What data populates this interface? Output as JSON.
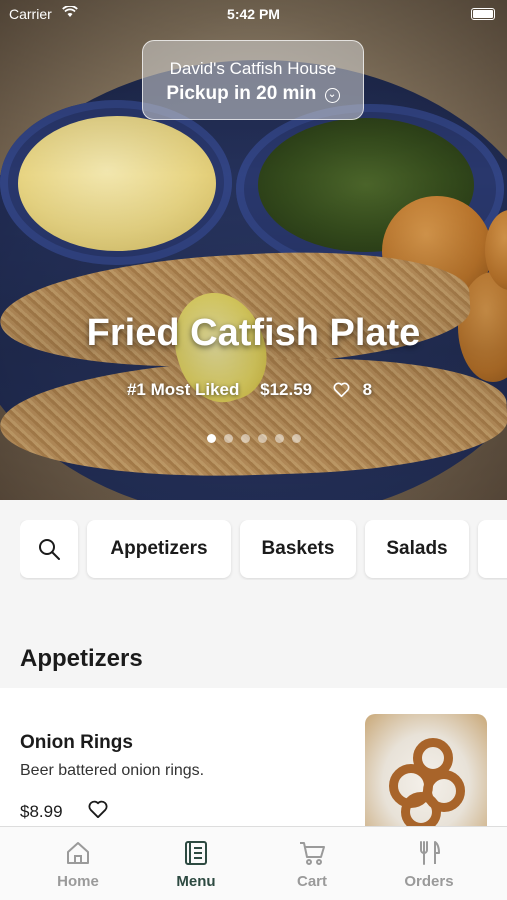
{
  "status_bar": {
    "carrier": "Carrier",
    "time": "5:42 PM"
  },
  "pickup": {
    "restaurant": "David's Catfish House",
    "label": "Pickup in 20 min"
  },
  "featured": {
    "title": "Fried Catfish Plate",
    "rank": "#1 Most Liked",
    "price": "$12.59",
    "likes": "8",
    "carousel_total": 6,
    "carousel_active_index": 0
  },
  "categories": [
    "Appetizers",
    "Baskets",
    "Salads"
  ],
  "section": {
    "title": "Appetizers"
  },
  "items": [
    {
      "name": "Onion Rings",
      "description": "Beer battered onion rings.",
      "price": "$8.99"
    }
  ],
  "tabs": [
    {
      "label": "Home",
      "icon": "home-icon",
      "active": false
    },
    {
      "label": "Menu",
      "icon": "menu-icon",
      "active": true
    },
    {
      "label": "Cart",
      "icon": "cart-icon",
      "active": false
    },
    {
      "label": "Orders",
      "icon": "orders-icon",
      "active": false
    }
  ],
  "colors": {
    "active_tab": "#2d4a41",
    "inactive_tab": "#9a9a9a"
  }
}
